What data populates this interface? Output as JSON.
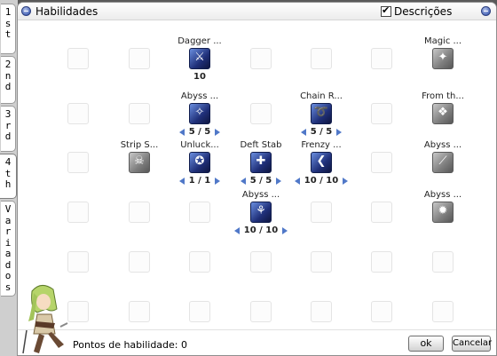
{
  "tabs": [
    "1st",
    "2nd",
    "3rd",
    "4th",
    "Variados"
  ],
  "window": {
    "title": "Habilidades",
    "descriptions_label": "Descrições",
    "descriptions_checked": true
  },
  "skills": [
    {
      "name": "Dagger ...",
      "level": "10",
      "arrows": false,
      "state": "active",
      "icon": "daggers-icon",
      "glyph": "⚔",
      "col": 0,
      "row": 0
    },
    {
      "name": "Magic ...",
      "level": "",
      "arrows": false,
      "state": "locked",
      "icon": "magic-icon",
      "glyph": "✦",
      "col": 4,
      "row": 0
    },
    {
      "name": "Abyss ...",
      "level": "5 / 5",
      "arrows": true,
      "state": "active",
      "icon": "abyss-icon",
      "glyph": "✧",
      "col": 0,
      "row": 1
    },
    {
      "name": "Chain R...",
      "level": "5 / 5",
      "arrows": true,
      "state": "active",
      "icon": "chain-icon",
      "glyph": "➰",
      "col": 2,
      "row": 1
    },
    {
      "name": "From th...",
      "level": "",
      "arrows": false,
      "state": "locked",
      "icon": "shadow-icon",
      "glyph": "❖",
      "col": 4,
      "row": 1
    },
    {
      "name": "Strip S...",
      "level": "",
      "arrows": false,
      "state": "locked",
      "icon": "strip-icon",
      "glyph": "☠",
      "col": -1,
      "row": 2
    },
    {
      "name": "Unluck...",
      "level": "1 / 1",
      "arrows": true,
      "state": "active",
      "icon": "unlucky-icon",
      "glyph": "✪",
      "col": 0,
      "row": 2
    },
    {
      "name": "Deft Stab",
      "level": "5 / 5",
      "arrows": true,
      "state": "active",
      "icon": "stab-icon",
      "glyph": "✚",
      "col": 1,
      "row": 2
    },
    {
      "name": "Frenzy ...",
      "level": "10 / 10",
      "arrows": true,
      "state": "active",
      "icon": "frenzy-icon",
      "glyph": "❮",
      "col": 2,
      "row": 2
    },
    {
      "name": "Abyss ...",
      "level": "",
      "arrows": false,
      "state": "locked",
      "icon": "abyss-slash-icon",
      "glyph": "⟋",
      "col": 4,
      "row": 2
    },
    {
      "name": "Abyss ...",
      "level": "10 / 10",
      "arrows": true,
      "state": "active",
      "icon": "abyss-squire-icon",
      "glyph": "⚘",
      "col": 1,
      "row": 3
    },
    {
      "name": "Abyss ...",
      "level": "",
      "arrows": false,
      "state": "locked",
      "icon": "abyss-flame-icon",
      "glyph": "✹",
      "col": 4,
      "row": 3
    }
  ],
  "footer": {
    "points": "Pontos de habilidade: 0",
    "ok_label": "ok",
    "cancel_label": "Cancelar"
  }
}
